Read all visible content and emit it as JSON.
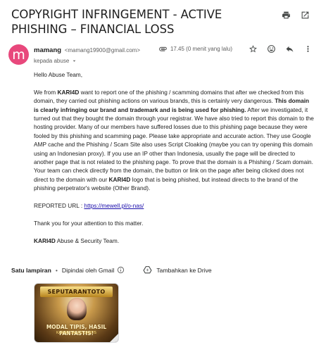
{
  "email": {
    "subject": "COPYRIGHT INFRINGEMENT - ACTIVE PHISHING – FINANCIAL LOSS",
    "sender_name": "mamang",
    "sender_email": "<mamang19900@gmail.com>",
    "avatar_letter": "m",
    "to_label": "kepada abuse",
    "time": "17.45 (0 menit yang lalu)",
    "greeting": "Hello Abuse Team,",
    "para1_a": "We from ",
    "brand": "KARI4D",
    "para1_b": " want to report one of the phishing / scamming domains that after we checked from this domain, they carried out phishing actions on various brands, this is certainly very dangerous. ",
    "para1_bold": "This domain is clearly infringing our brand and trademark and is being used for phishing.",
    "para1_c": " After we investigated, it turned out that they bought the domain through your registrar. We have also tried to report this domain to the hosting provider. Many of our members have suffered losses due to this phishing page because they were fooled by this phishing and scamming page. Please take appropriate and accurate action. They use Google AMP cache and the Phishing / Scam Site also uses Script Cloaking (maybe you can try opening this domain using an Indonesian proxy). If you use an IP other than Indonesia, usually the page will be directed to another page that is not related to the phishing page. To prove that the domain is a Phishing / Scam domain. Your team can check directly from the domain, the button or link on the page after being clicked does not direct to the domain with our ",
    "para1_d": " logo that is being phished, but instead directs to the brand of the phishing perpetrator's website (Other Brand).",
    "reported_label": "REPORTED URL : ",
    "reported_url": "https://mewell.pl/o-nas/",
    "thanks": "Thank you for your attention to this matter.",
    "sign_suffix": " Abuse & Security Team."
  },
  "attachments": {
    "title": "Satu lampiran",
    "scanned": "Dipindai oleh Gmail",
    "drive_label": "Tambahkan ke Drive",
    "thumb_banner": "SEPUTARANTOTO",
    "thumb_caption1": "MODAL TIPIS, HASIL FANTASTIS!",
    "thumb_caption2": "KARI4D SALDO GRATIS"
  },
  "colors": {
    "avatar": "#e8487c",
    "link": "#1a0dab"
  }
}
